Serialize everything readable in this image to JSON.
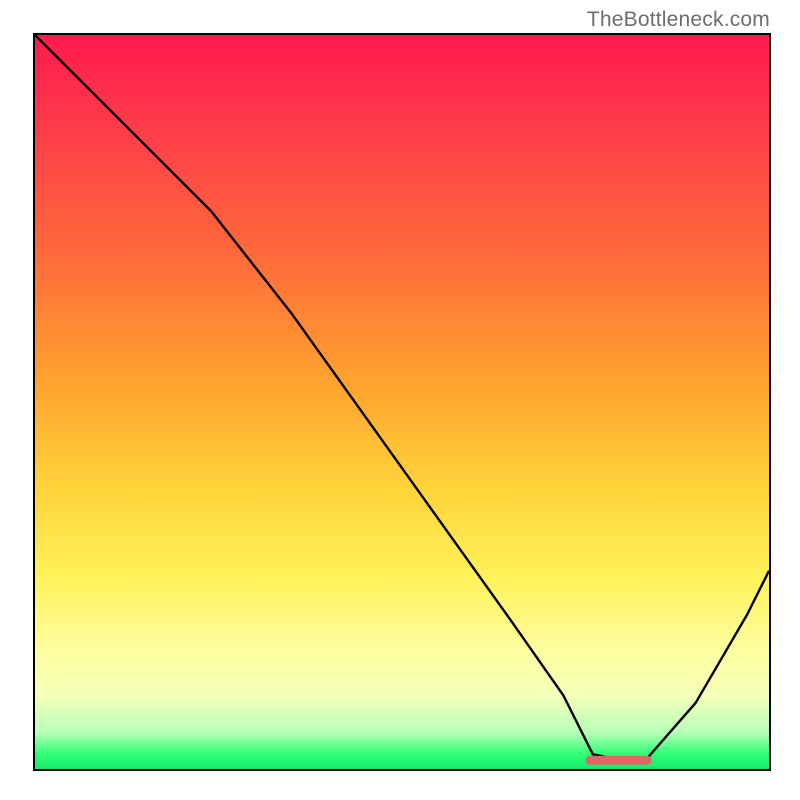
{
  "attribution": "TheBottleneck.com",
  "chart_data": {
    "type": "line",
    "title": "",
    "xlabel": "",
    "ylabel": "",
    "xlim": [
      0,
      100
    ],
    "ylim": [
      0,
      100
    ],
    "x": [
      0,
      10,
      24,
      35,
      45,
      55,
      65,
      72,
      74,
      76,
      81,
      83,
      90,
      97,
      100
    ],
    "values": [
      100,
      90,
      76,
      62,
      48,
      34,
      20,
      10,
      6,
      2,
      1,
      1,
      9,
      21,
      27
    ],
    "series": [
      {
        "name": "bottleneck-curve",
        "x": [
          0,
          10,
          24,
          35,
          45,
          55,
          65,
          72,
          74,
          76,
          81,
          83,
          90,
          97,
          100
        ],
        "values": [
          100,
          90,
          76,
          62,
          48,
          34,
          20,
          10,
          6,
          2,
          1,
          1,
          9,
          21,
          27
        ]
      }
    ],
    "optimal_marker": {
      "x_start": 75,
      "x_end": 84,
      "y": 1.2
    },
    "background_gradient": {
      "direction": "vertical",
      "stops": [
        {
          "pos": 0.0,
          "color": "#ff1a4d"
        },
        {
          "pos": 0.3,
          "color": "#ff6a3a"
        },
        {
          "pos": 0.62,
          "color": "#ffd43a"
        },
        {
          "pos": 0.84,
          "color": "#fdfea0"
        },
        {
          "pos": 0.95,
          "color": "#b8ffb8"
        },
        {
          "pos": 1.0,
          "color": "#17e86b"
        }
      ]
    },
    "colors": {
      "curve": "#000000",
      "optimal_marker": "#e06666",
      "border": "#000000"
    }
  }
}
